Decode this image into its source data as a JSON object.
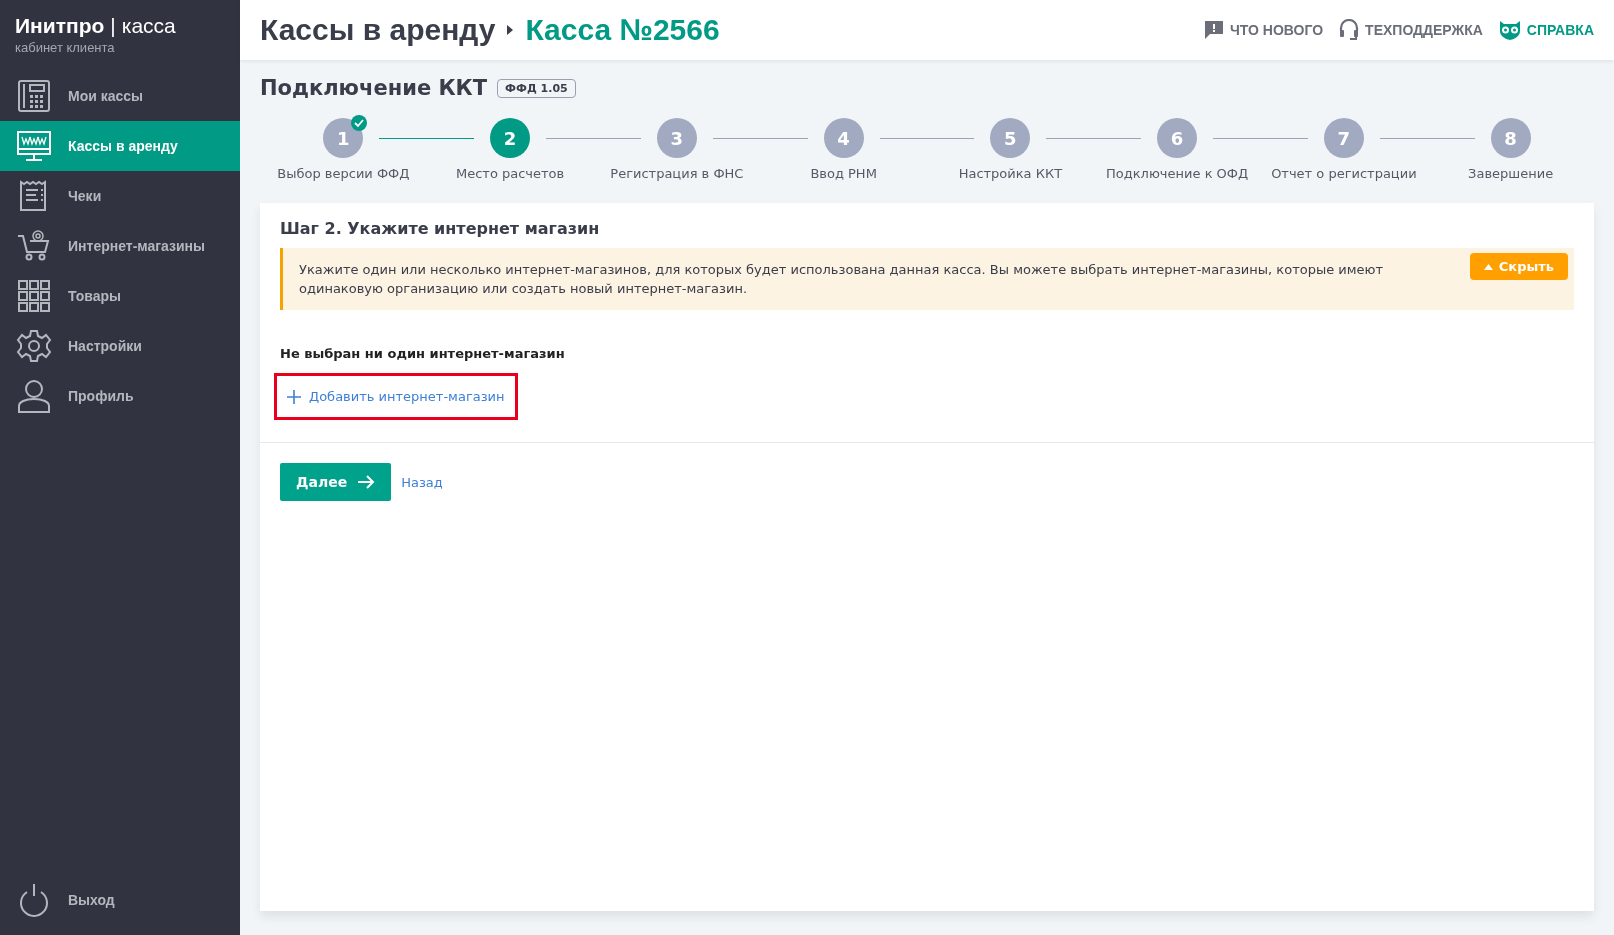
{
  "sidebar": {
    "brand": {
      "name": "Инитпро",
      "separator": "|",
      "product": "касса",
      "subtitle": "кабинет клиента"
    },
    "items": [
      {
        "label": "Мои кассы",
        "selected": false
      },
      {
        "label": "Кассы в аренду",
        "selected": true
      },
      {
        "label": "Чеки",
        "selected": false
      },
      {
        "label": "Интернет-магазины",
        "selected": false
      },
      {
        "label": "Товары",
        "selected": false
      },
      {
        "label": "Настройки",
        "selected": false
      },
      {
        "label": "Профиль",
        "selected": false
      }
    ],
    "logout": {
      "label": "Выход"
    }
  },
  "header": {
    "breadcrumb": [
      "Кассы в аренду",
      "Касса №2566"
    ],
    "links": [
      {
        "label": "ЧТО НОВОГО",
        "accent": false
      },
      {
        "label": "ТЕХПОДДЕРЖКА",
        "accent": false
      },
      {
        "label": "СПРАВКА",
        "accent": true
      }
    ]
  },
  "page": {
    "title": "Подключение ККТ",
    "badge": "ФФД 1.05"
  },
  "steps": [
    {
      "number": "1",
      "label": "Выбор версии ФФД",
      "done": true,
      "selected": false
    },
    {
      "number": "2",
      "label": "Место расчетов",
      "done": false,
      "selected": true
    },
    {
      "number": "3",
      "label": "Регистрация в ФНС",
      "done": false,
      "selected": false
    },
    {
      "number": "4",
      "label": "Ввод РНМ",
      "done": false,
      "selected": false
    },
    {
      "number": "5",
      "label": "Настройка ККТ",
      "done": false,
      "selected": false
    },
    {
      "number": "6",
      "label": "Подключение к ОФД",
      "done": false,
      "selected": false
    },
    {
      "number": "7",
      "label": "Отчет о регистрации",
      "done": false,
      "selected": false
    },
    {
      "number": "8",
      "label": "Завершение",
      "done": false,
      "selected": false
    }
  ],
  "card": {
    "title": "Шаг 2. Укажите интернет магазин",
    "notice": {
      "text": "Укажите один или несколько интернет-магазинов, для которых будет использована данная касса. Вы можете выбрать интернет-магазины, которые имеют одинаковую организацию или создать новый интернет-магазин.",
      "button": "Скрыть",
      "expanded": true
    },
    "empty_text": "Не выбран ни один интернет-магазин",
    "add_link": {
      "label": "Добавить интернет-магазин",
      "highlighted": true
    },
    "next_button": "Далее",
    "back_link": "Назад"
  }
}
